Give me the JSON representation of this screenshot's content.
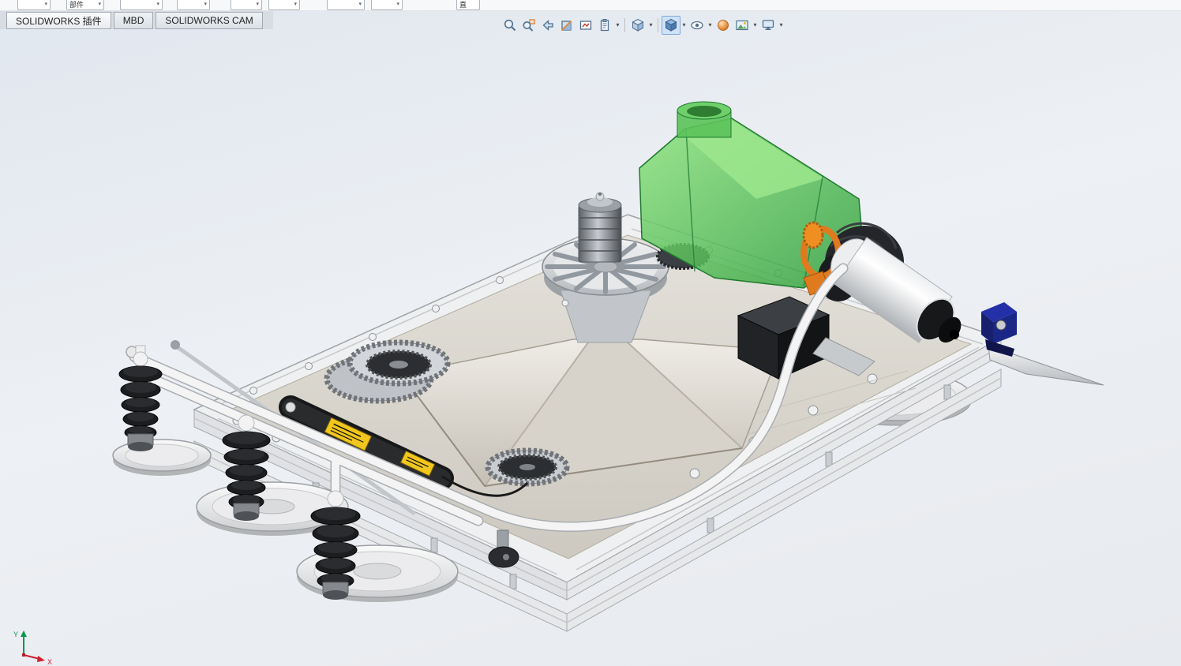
{
  "app": {
    "name": "SOLIDWORKS"
  },
  "top_ribbon": {
    "labels": {
      "component": "部件",
      "vertical": "直"
    }
  },
  "tabs": {
    "items": [
      {
        "label": "SOLIDWORKS 插件"
      },
      {
        "label": "MBD"
      },
      {
        "label": "SOLIDWORKS CAM"
      }
    ]
  },
  "heads_up_toolbar": {
    "tools": [
      {
        "name": "zoom-to-fit",
        "dropdown": false,
        "active": false
      },
      {
        "name": "zoom-to-area",
        "dropdown": false,
        "active": false
      },
      {
        "name": "previous-view",
        "dropdown": false,
        "active": false
      },
      {
        "name": "section-view",
        "dropdown": false,
        "active": false
      },
      {
        "name": "3d-drawing-view",
        "dropdown": false,
        "active": false
      },
      {
        "name": "annotations",
        "dropdown": true,
        "active": false
      },
      {
        "name": "view-orientation",
        "dropdown": true,
        "active": false
      },
      {
        "name": "display-style",
        "dropdown": true,
        "active": true
      },
      {
        "name": "hide-show-items",
        "dropdown": true,
        "active": false
      },
      {
        "name": "edit-appearance",
        "dropdown": false,
        "active": false
      },
      {
        "name": "apply-scene",
        "dropdown": true,
        "active": false
      },
      {
        "name": "view-settings",
        "dropdown": true,
        "active": false
      }
    ]
  },
  "viewport": {
    "triad": {
      "x": "X",
      "y": "Y"
    },
    "background_top": "#e1e7ef",
    "background_bottom": "#e7eaee"
  },
  "model": {
    "type": "3d-assembly",
    "description": "robot chassis on aluminum extrusion frame with central impeller cone, green hopper funnel, white pump motor, gear wheels, three rubber suction bellows on discs and white tubing",
    "colors": {
      "hopper_green": "#46b14e",
      "hopper_green_light": "#9fe98f",
      "frame_silver": "#eef0f1",
      "deck_gray": "#d8d4cb",
      "motor_white": "#f5f5f5",
      "coupling_orange": "#e07a1f",
      "rubber_black": "#1c1d1f",
      "clamp_blue": "#2430a8",
      "esc_yellow": "#f2c71d"
    }
  }
}
